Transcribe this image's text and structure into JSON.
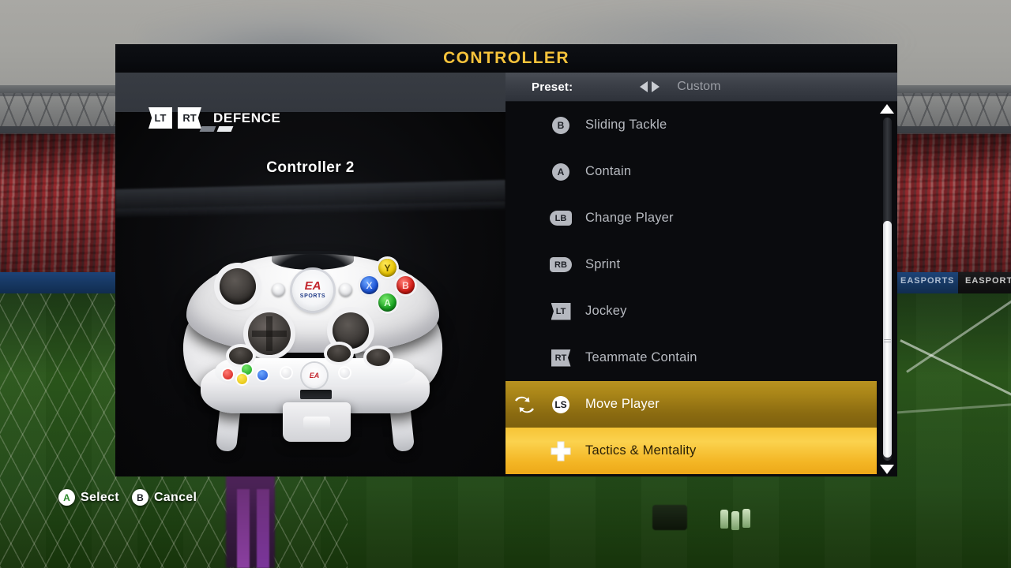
{
  "window": {
    "title": "CONTROLLER"
  },
  "left_panel": {
    "section_label": "DEFENCE",
    "trigger_badges": [
      "LT",
      "RT"
    ],
    "page_indicator": {
      "total": 2,
      "active": 2
    },
    "controller_label": "Controller 2",
    "controller_brand": "EA",
    "controller_brand_sub": "SPORTS",
    "face_buttons": [
      "Y",
      "X",
      "B",
      "A"
    ]
  },
  "right_panel": {
    "preset": {
      "label": "Preset:",
      "value": "Custom",
      "left_arrow": "prev-preset-arrow",
      "right_arrow": "next-preset-arrow"
    },
    "bindings": [
      {
        "button": "B",
        "icon": "b-button-icon",
        "icon_style": "circle",
        "action": "Sliding Tackle",
        "selected": false
      },
      {
        "button": "A",
        "icon": "a-button-icon",
        "icon_style": "circle",
        "action": "Contain",
        "selected": false
      },
      {
        "button": "LB",
        "icon": "lb-bumper-icon",
        "icon_style": "bumper-left",
        "action": "Change Player",
        "selected": false
      },
      {
        "button": "RB",
        "icon": "rb-bumper-icon",
        "icon_style": "bumper-right",
        "action": "Sprint",
        "selected": false
      },
      {
        "button": "LT",
        "icon": "lt-trigger-icon",
        "icon_style": "trigger-left",
        "action": "Jockey",
        "selected": false
      },
      {
        "button": "RT",
        "icon": "rt-trigger-icon",
        "icon_style": "trigger-right",
        "action": "Teammate Contain",
        "selected": false
      },
      {
        "button": "LS",
        "icon": "ls-stick-icon",
        "icon_style": "circle-white",
        "action": "Move Player",
        "selected": true,
        "lead_icon": "swap-arrows-icon"
      },
      {
        "button": "",
        "icon": "dpad-cross-icon",
        "icon_style": "cross",
        "action": "Tactics & Mentality",
        "selected": true
      }
    ],
    "scrollbar": {
      "up": "scroll-up-arrow",
      "down": "scroll-down-arrow"
    }
  },
  "footer": {
    "actions": [
      {
        "button": "A",
        "label": "Select"
      },
      {
        "button": "B",
        "label": "Cancel"
      }
    ]
  },
  "background": {
    "adboard_text_left": "EASPORTS",
    "adboard_text_right": "EASPORTS"
  },
  "colors": {
    "title_gold": "#f6c33b",
    "highlight_dark_gold": "#a98518",
    "highlight_bright_gold": "#f6c436",
    "panel_dark": "#0a0b0e",
    "panel_gray": "#3b3f46"
  }
}
